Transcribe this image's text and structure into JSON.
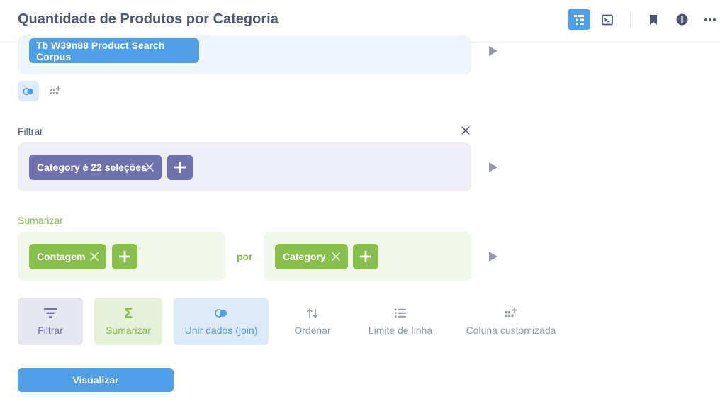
{
  "header": {
    "title": "Quantidade de Produtos por Categoria"
  },
  "data_step": {
    "table_name": "Tb W39n88 Product Search Corpus"
  },
  "filter_step": {
    "label": "Filtrar",
    "pill": "Category é 22 seleções"
  },
  "summarize_step": {
    "label": "Sumarizar",
    "metric_pill": "Contagem",
    "by_label": "por",
    "group_pill": "Category"
  },
  "actions": {
    "filter": "Filtrar",
    "summarize": "Sumarizar",
    "join": "Unir dados (join)",
    "sort": "Ordenar",
    "limit": "Limite de linha",
    "custom_column": "Coluna customizada"
  },
  "visualize_button": "Visualizar",
  "colors": {
    "brand": "#509ee3",
    "filter": "#7172ad",
    "summarize": "#88bf4d",
    "text_dark": "#4c5773",
    "text_muted": "#949aab"
  }
}
